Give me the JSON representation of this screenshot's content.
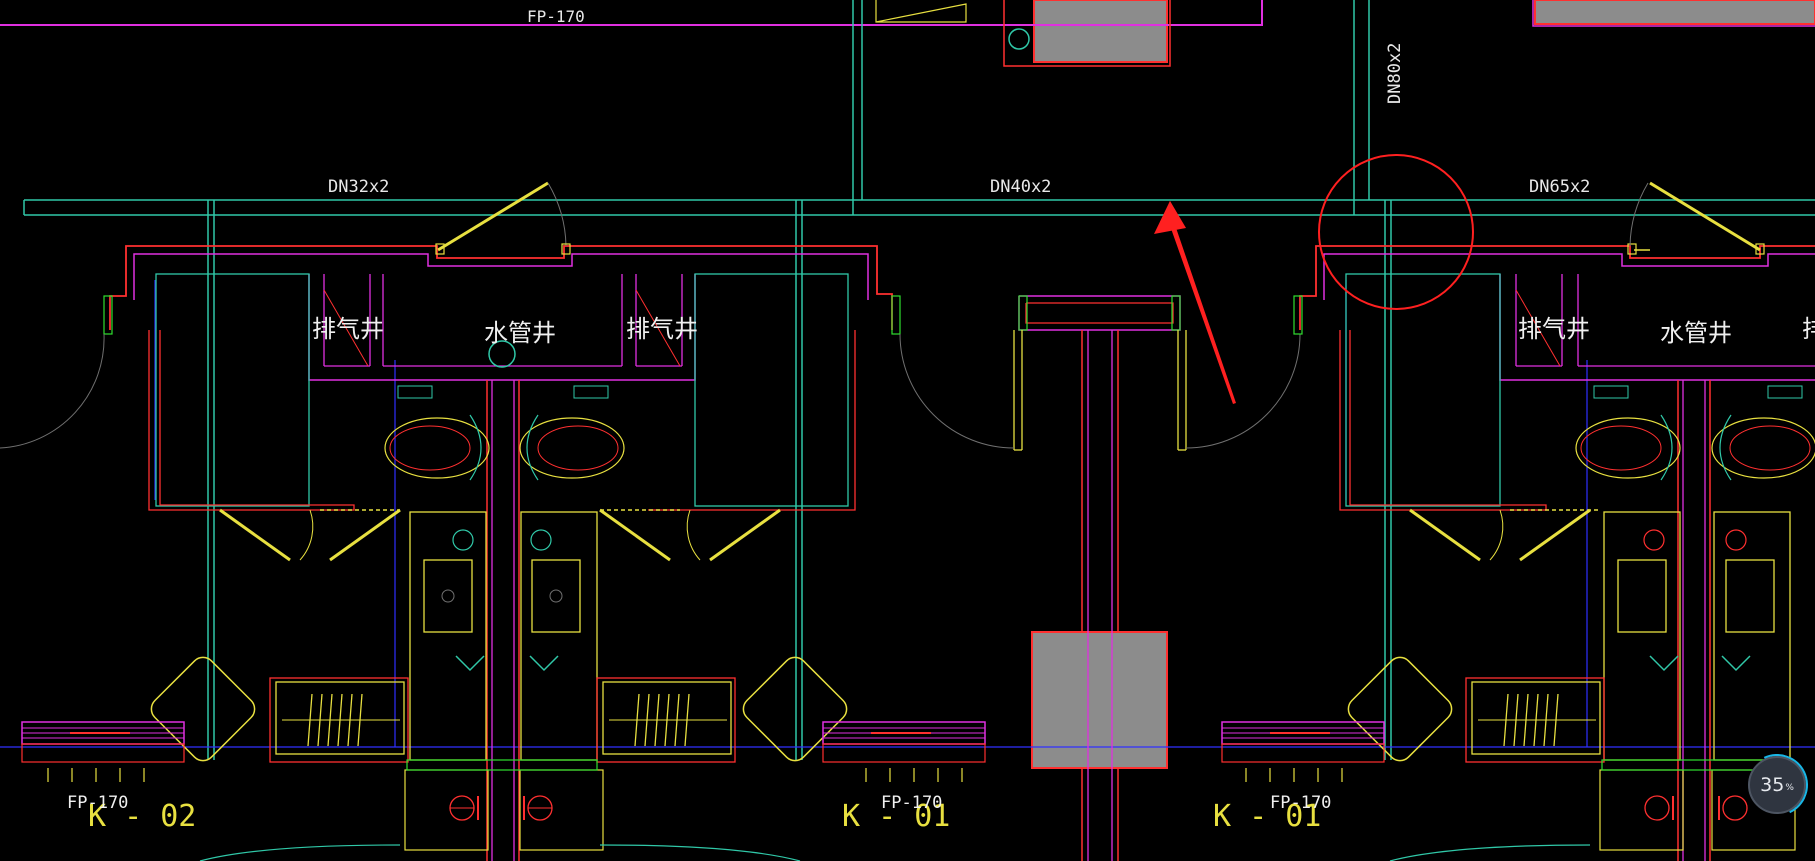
{
  "pipes": {
    "top_label": "FP-170",
    "dn32": "DN32x2",
    "dn40": "DN40x2",
    "dn65": "DN65x2",
    "dn80": "DN80x2"
  },
  "rooms": {
    "left": {
      "exhaust_a": "排气井",
      "water": "水管井",
      "exhaust_b": "排气井"
    },
    "right": {
      "exhaust_a": "排气井",
      "water": "水管井",
      "exhaust_b": "排"
    }
  },
  "units": {
    "k02": "K - 02",
    "k01a": "K - 01",
    "k01b": "K - 01"
  },
  "fan_coils": {
    "label_a": "FP-170",
    "label_b": "FP-170",
    "label_c": "FP-170"
  },
  "zoom": {
    "value": "35",
    "unit": "%"
  },
  "colors": {
    "background": "#000000",
    "pipe": "#30c8a8",
    "wall": "#ff3030",
    "wall_inner": "#e030e0",
    "fixture": "#e8e040",
    "annotation": "#ff2020",
    "duct_fill": "#8c8c8c",
    "aux_line": "#3030ff"
  }
}
